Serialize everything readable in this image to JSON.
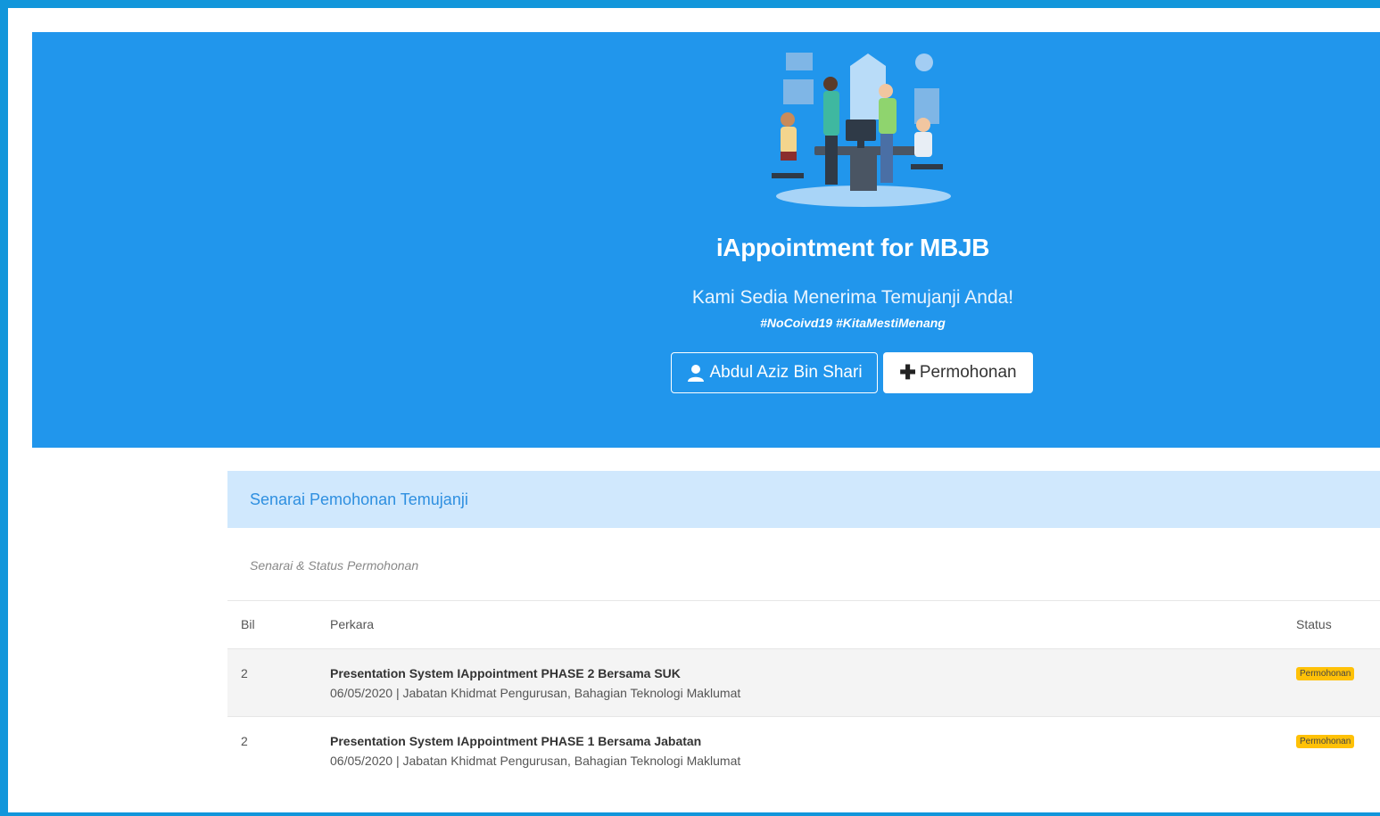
{
  "hero": {
    "illustration": "team-meeting-illustration",
    "title": "iAppointment for MBJB",
    "subtitle": "Kami Sedia Menerima Temujanji Anda!",
    "tags": "#NoCoivd19 #KitaMestiMenang",
    "user_button": {
      "icon": "user-icon",
      "label": "Abdul Aziz Bin Shari"
    },
    "new_button": {
      "icon": "plus-icon",
      "label": "Permohonan"
    }
  },
  "list": {
    "title": "Senarai Pemohonan Temujanji",
    "description": "Senarai & Status Permohonan",
    "columns": {
      "bil": "Bil",
      "perkara": "Perkara",
      "status": "Status"
    },
    "rows": [
      {
        "bil": "2",
        "title": "Presentation System IAppointment PHASE 2 Bersama SUK",
        "meta": "06/05/2020 | Jabatan Khidmat Pengurusan, Bahagian Teknologi Maklumat",
        "status": "Permohonan"
      },
      {
        "bil": "2",
        "title": "Presentation System IAppointment PHASE 1 Bersama Jabatan",
        "meta": "06/05/2020 | Jabatan Khidmat Pengurusan, Bahagian Teknologi Maklumat",
        "status": "Permohonan"
      }
    ]
  },
  "colors": {
    "outer_frame": "#1296db",
    "hero_background": "#2196ec",
    "card_header": "#d0e8fd",
    "card_title": "#2e8fe0",
    "status_badge": "#ffc107"
  }
}
